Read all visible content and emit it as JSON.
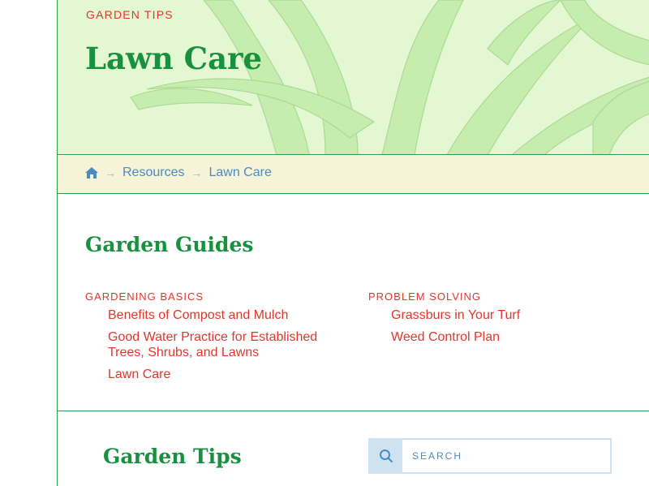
{
  "hero": {
    "eyebrow": "GARDEN TIPS",
    "title": "Lawn Care"
  },
  "breadcrumb": {
    "home_icon": "home-icon",
    "items": [
      "Resources",
      "Lawn Care"
    ],
    "separator": "→"
  },
  "guides": {
    "title": "Garden Guides",
    "columns": [
      {
        "heading": "GARDENING BASICS",
        "links": [
          "Benefits of Compost and Mulch",
          "Good Water Practice for Established Trees, Shrubs, and Lawns",
          "Lawn Care"
        ]
      },
      {
        "heading": "PROBLEM SOLVING",
        "links": [
          "Grassburs in Your Turf",
          "Weed Control Plan"
        ]
      }
    ]
  },
  "tips": {
    "title": "Garden Tips"
  },
  "search": {
    "icon": "search-icon",
    "placeholder": "SEARCH"
  },
  "colors": {
    "green": "#17913f",
    "red": "#e2362b",
    "blue": "#4a8bc0",
    "hero_bg": "#e3f7d2",
    "crumb_bg": "#f6f3d9"
  }
}
